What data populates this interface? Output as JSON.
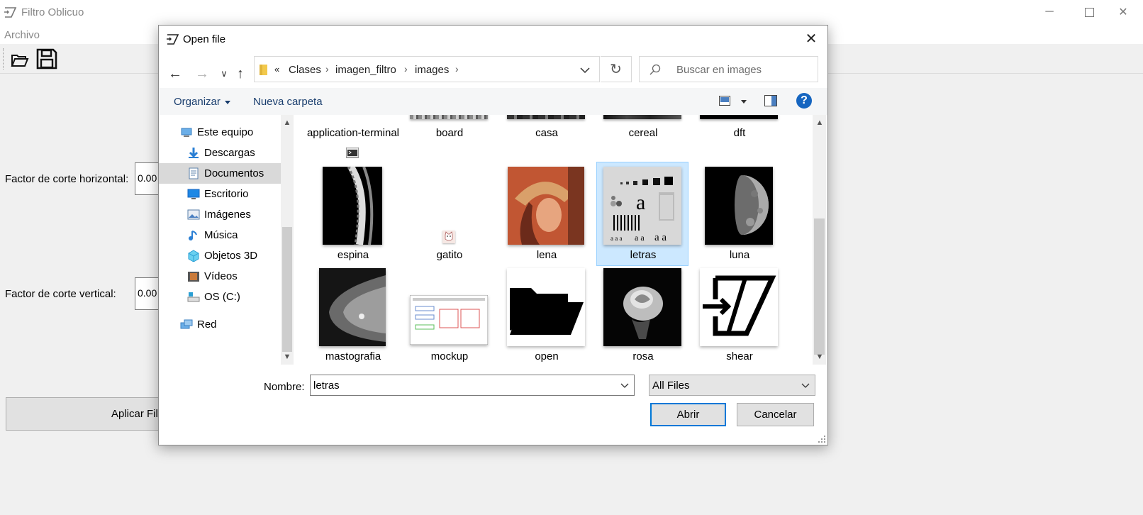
{
  "app": {
    "title": "Filtro Oblicuo",
    "menu": [
      "Archivo"
    ],
    "fields": {
      "horizontal_label": "Factor de corte horizontal:",
      "horizontal_value": "0.00",
      "vertical_label": "Factor de corte vertical:",
      "vertical_value": "0.00"
    },
    "apply_button": "Aplicar Filtro"
  },
  "dialog": {
    "title": "Open file",
    "breadcrumb": [
      "«",
      "Clases",
      "imagen_filtro",
      "images"
    ],
    "search_placeholder": "Buscar en images",
    "commands": {
      "organize": "Organizar",
      "new_folder": "Nueva carpeta"
    },
    "nav_items": [
      {
        "label": "Este equipo",
        "icon": "computer-icon"
      },
      {
        "label": "Descargas",
        "icon": "download-icon"
      },
      {
        "label": "Documentos",
        "icon": "documents-icon",
        "selected": true
      },
      {
        "label": "Escritorio",
        "icon": "desktop-icon"
      },
      {
        "label": "Imágenes",
        "icon": "pictures-icon"
      },
      {
        "label": "Música",
        "icon": "music-icon"
      },
      {
        "label": "Objetos 3D",
        "icon": "3d-objects-icon"
      },
      {
        "label": "Vídeos",
        "icon": "videos-icon"
      },
      {
        "label": "OS (C:)",
        "icon": "drive-icon"
      },
      {
        "label": "Red",
        "icon": "network-icon"
      }
    ],
    "files_row1": [
      "application-terminal",
      "board",
      "casa",
      "cereal",
      "dft"
    ],
    "files_row2": [
      "espina",
      "gatito",
      "lena",
      "letras",
      "luna"
    ],
    "files_row3": [
      "mastografia",
      "mockup",
      "open",
      "rosa",
      "shear"
    ],
    "selected_file": "letras",
    "filename_label": "Nombre:",
    "filename_value": "letras",
    "filter": "All Files",
    "open_button": "Abrir",
    "cancel_button": "Cancelar"
  },
  "colors": {
    "accent": "#0078d7",
    "selection": "#cce8ff",
    "link": "#1a3e6e",
    "help": "#1565c0"
  }
}
